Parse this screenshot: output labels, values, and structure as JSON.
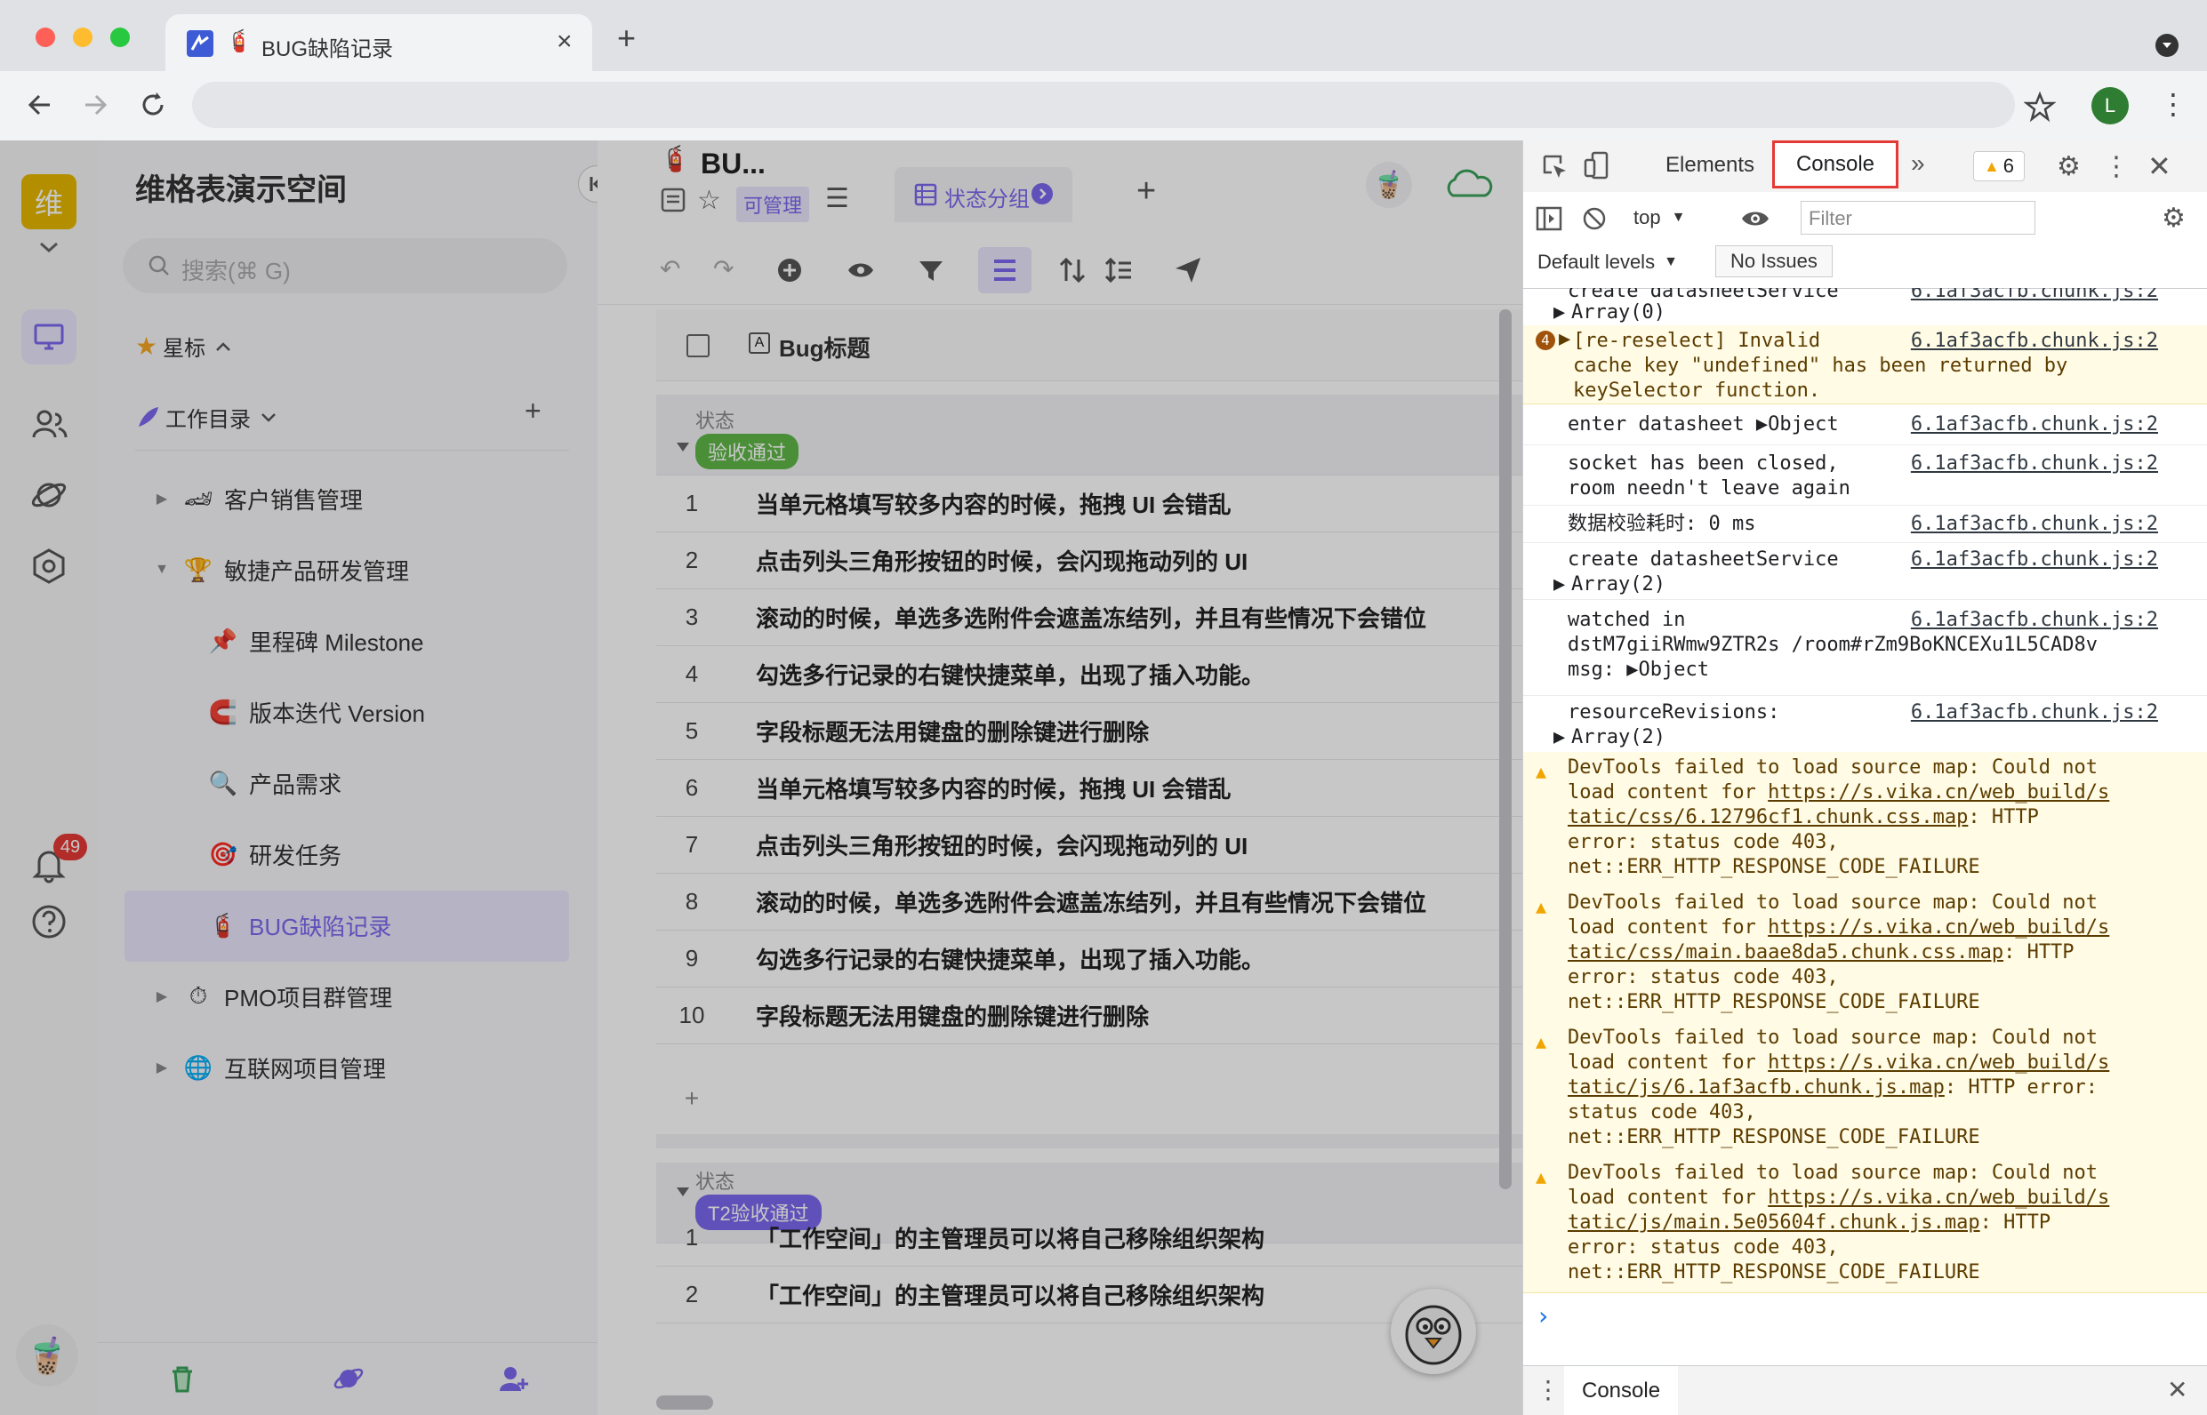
{
  "browser": {
    "tab_title": "BUG缺陷记录",
    "profile_initial": "L",
    "new_tab": "+",
    "close_tab": "×"
  },
  "rail": {
    "workspace_initial": "维",
    "notification_count": "49"
  },
  "sidebar": {
    "space_name": "维格表演示空间",
    "search_placeholder": "搜索(⌘ G)",
    "starred_label": "星标",
    "catalog_label": "工作目录",
    "items": [
      {
        "label": "客户销售管理",
        "icon": "sales-icon"
      },
      {
        "label": "敏捷产品研发管理",
        "icon": "trophy-icon"
      },
      {
        "label": "里程碑 Milestone",
        "icon": "pin-icon"
      },
      {
        "label": "版本迭代 Version",
        "icon": "magnet-icon"
      },
      {
        "label": "产品需求",
        "icon": "magnifier-icon"
      },
      {
        "label": "研发任务",
        "icon": "target-icon"
      },
      {
        "label": "BUG缺陷记录",
        "icon": "extinguisher-icon"
      },
      {
        "label": "PMO项目群管理",
        "icon": "stopwatch-icon"
      },
      {
        "label": "互联网项目管理",
        "icon": "globe-icon"
      }
    ]
  },
  "main": {
    "title": "BU...",
    "permission": "可管理",
    "view_tab": "状态分组",
    "column_header": "Bug标题",
    "group1": {
      "field_label": "状态",
      "tag": "验收通过",
      "rows": [
        {
          "num": "1",
          "text": "当单元格填写较多内容的时候，拖拽 UI 会错乱"
        },
        {
          "num": "2",
          "text": "点击列头三角形按钮的时候，会闪现拖动列的 UI"
        },
        {
          "num": "3",
          "text": "滚动的时候，单选多选附件会遮盖冻结列，并且有些情况下会错位"
        },
        {
          "num": "4",
          "text": "勾选多行记录的右键快捷菜单，出现了插入功能。"
        },
        {
          "num": "5",
          "text": "字段标题无法用键盘的删除键进行删除"
        },
        {
          "num": "6",
          "text": "当单元格填写较多内容的时候，拖拽 UI 会错乱"
        },
        {
          "num": "7",
          "text": "点击列头三角形按钮的时候，会闪现拖动列的 UI"
        },
        {
          "num": "8",
          "text": "滚动的时候，单选多选附件会遮盖冻结列，并且有些情况下会错位"
        },
        {
          "num": "9",
          "text": "勾选多行记录的右键快捷菜单，出现了插入功能。"
        },
        {
          "num": "10",
          "text": "字段标题无法用键盘的删除键进行删除"
        }
      ],
      "add_row": "+"
    },
    "group2": {
      "field_label": "状态",
      "tag": "T2验收通过",
      "rows": [
        {
          "num": "1",
          "text": "「工作空间」的主管理员可以将自己移除组织架构"
        },
        {
          "num": "2",
          "text": "「工作空间」的主管理员可以将自己移除组织架构"
        }
      ]
    }
  },
  "devtools": {
    "tabs": [
      "Elements",
      "Console"
    ],
    "active_tab": "Console",
    "more": "»",
    "warning_count": "6",
    "context": "top",
    "filter_placeholder": "Filter",
    "levels": "Default levels",
    "issues": "No Issues",
    "drawer_tab": "Console",
    "prompt": "›",
    "messages": [
      {
        "text": "create datasheetService",
        "src": "6.1af3acfb.chunk.js:2",
        "sub": "Array(0)"
      },
      {
        "text": "[re-reselect] Invalid\ncache key \"undefined\" has been returned by\nkeySelector function.",
        "src": "6.1af3acfb.chunk.js:2",
        "count": "4"
      },
      {
        "text": "enter datasheet ▶Object",
        "src": "6.1af3acfb.chunk.js:2"
      },
      {
        "text": "socket has been closed,\nroom needn't leave again",
        "src": "6.1af3acfb.chunk.js:2"
      },
      {
        "text": "数据校验耗时: 0 ms",
        "src": "6.1af3acfb.chunk.js:2"
      },
      {
        "text": "create datasheetService",
        "src": "6.1af3acfb.chunk.js:2",
        "sub": "Array(2)"
      },
      {
        "text": "watched in\ndstM7giiRWmw9ZTR2s /room#rZm9BoKNCEXu1L5CAD8v\nmsg: ▶Object",
        "src": "6.1af3acfb.chunk.js:2"
      },
      {
        "text": "resourceRevisions:",
        "src": "6.1af3acfb.chunk.js:2",
        "sub": "Array(2)"
      }
    ],
    "warnings": [
      {
        "pre": "DevTools failed to load source map: Could not\nload content for ",
        "url": "https://s.vika.cn/web_build/s\ntatic/css/6.12796cf1.chunk.css.map",
        "post": ": HTTP\nerror: status code 403,\nnet::ERR_HTTP_RESPONSE_CODE_FAILURE"
      },
      {
        "pre": "DevTools failed to load source map: Could not\nload content for ",
        "url": "https://s.vika.cn/web_build/s\ntatic/css/main.baae8da5.chunk.css.map",
        "post": ": HTTP\nerror: status code 403,\nnet::ERR_HTTP_RESPONSE_CODE_FAILURE"
      },
      {
        "pre": "DevTools failed to load source map: Could not\nload content for ",
        "url": "https://s.vika.cn/web_build/s\ntatic/js/6.1af3acfb.chunk.js.map",
        "post": ": HTTP error:\nstatus code 403,\nnet::ERR_HTTP_RESPONSE_CODE_FAILURE"
      },
      {
        "pre": "DevTools failed to load source map: Could not\nload content for ",
        "url": "https://s.vika.cn/web_build/s\ntatic/js/main.5e05604f.chunk.js.map",
        "post": ": HTTP\nerror: status code 403,\nnet::ERR_HTTP_RESPONSE_CODE_FAILURE"
      }
    ]
  },
  "colors": {
    "accent": "#7b67ee",
    "green_tag": "#5fb848",
    "console_highlight": "#e53935",
    "warning_bg": "#fffbe5"
  }
}
